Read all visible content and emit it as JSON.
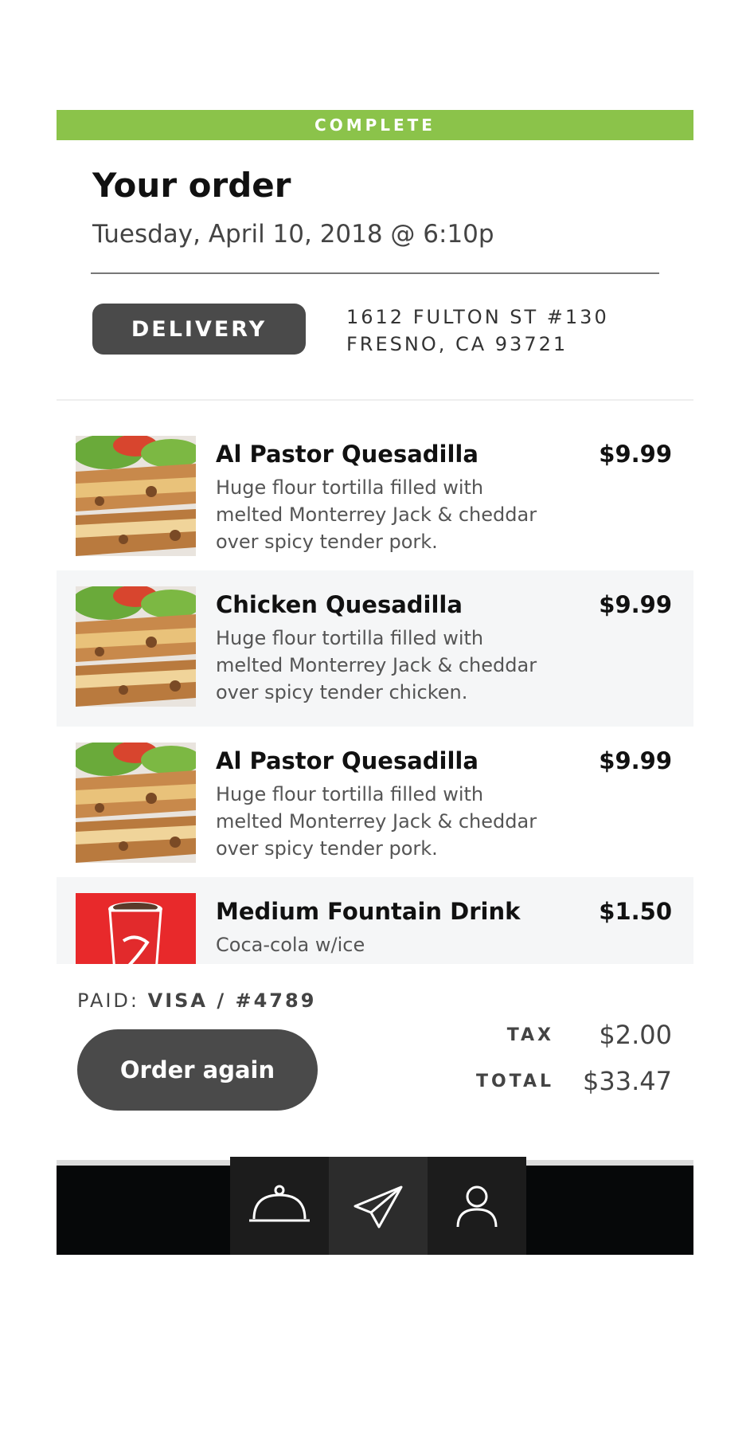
{
  "colors": {
    "status_complete": "#8bc34a",
    "pill_dark": "#4a4a4a",
    "tabbar_bg": "#060809",
    "tab_bg": "#1c1c1c",
    "tab_active_bg": "#2c2c2c",
    "item_alt_bg": "#f5f6f7"
  },
  "status": {
    "label": "COMPLETE"
  },
  "order": {
    "title": "Your order",
    "datetime": "Tuesday, April 10, 2018 @ 6:10p",
    "method": "DELIVERY",
    "address_line1": "1612 FULTON ST #130",
    "address_line2": "FRESNO, CA 93721"
  },
  "items": [
    {
      "name": "Al Pastor Quesadilla",
      "price": "$9.99",
      "desc_lines": [
        "Huge flour tortilla filled with",
        "melted Monterrey Jack & cheddar",
        "over spicy tender pork."
      ],
      "image": "quesadilla-photo"
    },
    {
      "name": "Chicken Quesadilla",
      "price": "$9.99",
      "desc_lines": [
        "Huge flour tortilla filled with",
        "melted Monterrey Jack & cheddar",
        "over spicy tender chicken."
      ],
      "image": "quesadilla-photo"
    },
    {
      "name": "Al Pastor Quesadilla",
      "price": "$9.99",
      "desc_lines": [
        "Huge flour tortilla filled with",
        "melted Monterrey Jack & cheddar",
        "over spicy tender pork."
      ],
      "image": "quesadilla-photo"
    },
    {
      "name": "Medium Fountain Drink",
      "price": "$1.50",
      "desc_lines": [
        "Coca-cola w/ice"
      ],
      "image": "coca-cola-cup-photo"
    }
  ],
  "payment": {
    "label": "PAID:",
    "method": "VISA / #4789"
  },
  "actions": {
    "order_again": "Order again"
  },
  "totals": {
    "tax_label": "TAX",
    "tax_value": "$2.00",
    "total_label": "TOTAL",
    "total_value": "$33.47"
  },
  "tabbar": {
    "tabs": [
      {
        "icon": "food-cloche-icon",
        "active": false
      },
      {
        "icon": "send-paper-plane-icon",
        "active": true
      },
      {
        "icon": "user-profile-icon",
        "active": false
      }
    ]
  }
}
